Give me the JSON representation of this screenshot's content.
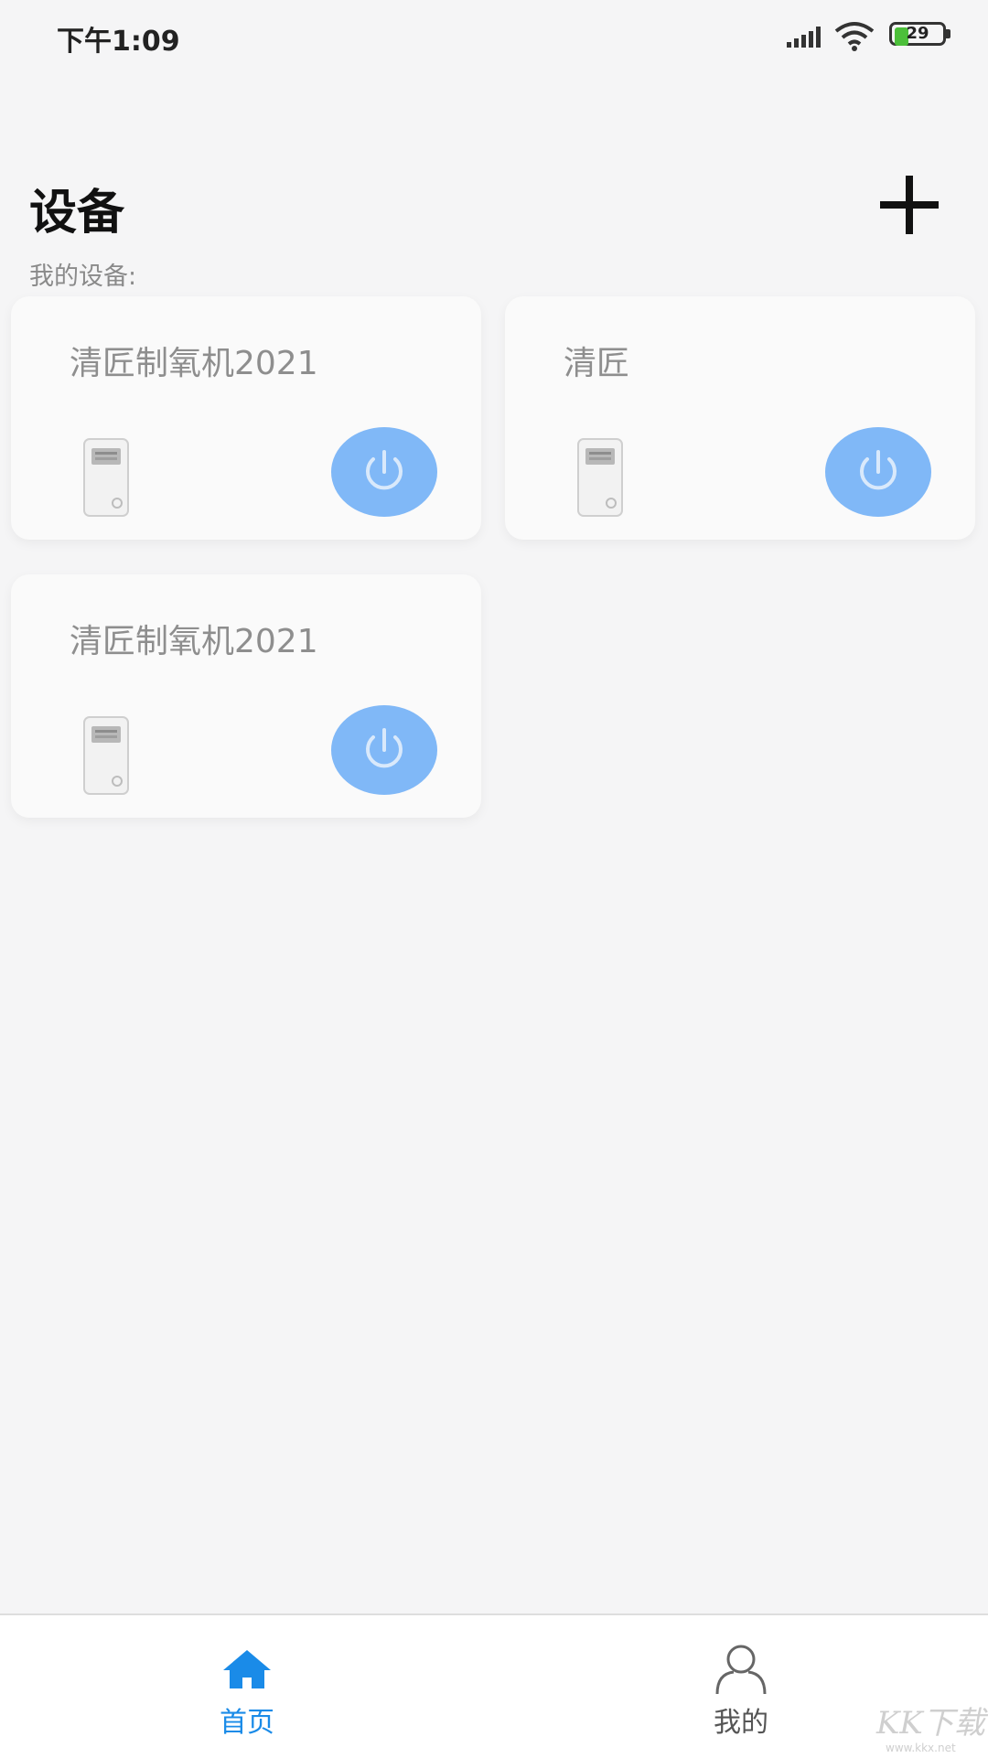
{
  "status_bar": {
    "time": "下午1:09",
    "battery_level": "29",
    "battery_fill_percent": 29
  },
  "header": {
    "title": "设备",
    "add_icon": "plus-icon"
  },
  "section": {
    "label": "我的设备:"
  },
  "devices": [
    {
      "name": "清匠制氧机2021",
      "power_icon": "power-icon"
    },
    {
      "name": "清匠",
      "power_icon": "power-icon"
    },
    {
      "name": "清匠制氧机2021",
      "power_icon": "power-icon"
    }
  ],
  "bottom_nav": {
    "items": [
      {
        "label": "首页",
        "icon": "home-icon",
        "active": true
      },
      {
        "label": "我的",
        "icon": "user-icon",
        "active": false
      }
    ]
  },
  "watermark": {
    "logo_text": "KK下载",
    "url": "www.kkx.net"
  },
  "colors": {
    "accent": "#1a8be8",
    "power_button": "#80b8f7",
    "background": "#f5f5f6",
    "inactive_nav": "#555555"
  }
}
